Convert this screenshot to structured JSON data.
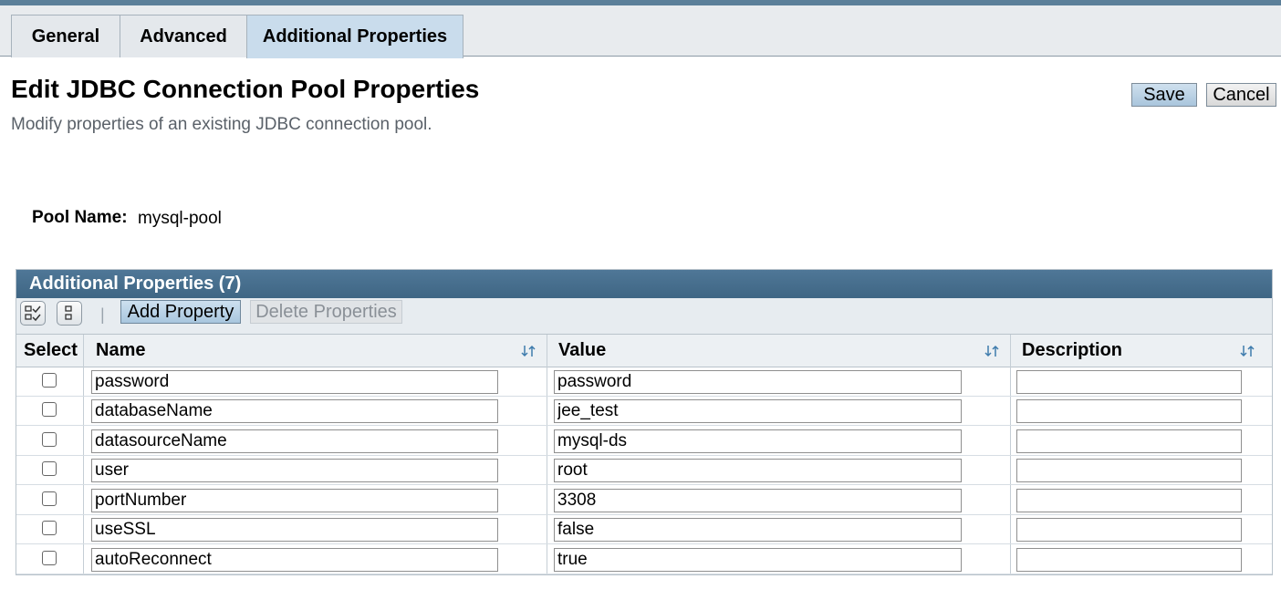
{
  "tabs": [
    {
      "label": "General"
    },
    {
      "label": "Advanced"
    },
    {
      "label": "Additional Properties"
    }
  ],
  "page": {
    "title": "Edit JDBC Connection Pool Properties",
    "help": "Modify properties of an existing JDBC connection pool."
  },
  "actions": {
    "save": "Save",
    "cancel": "Cancel"
  },
  "pool": {
    "label": "Pool Name:",
    "value": "mysql-pool"
  },
  "table": {
    "title": "Additional Properties (7)",
    "toolbar": {
      "select_all_icon": "select-all-icon",
      "deselect_all_icon": "deselect-all-icon",
      "separator": "|",
      "add": "Add Property",
      "delete": "Delete Properties"
    },
    "columns": {
      "select": "Select",
      "name": "Name",
      "value": "Value",
      "description": "Description"
    },
    "rows": [
      {
        "name": "password",
        "value": "password",
        "description": ""
      },
      {
        "name": "databaseName",
        "value": "jee_test",
        "description": ""
      },
      {
        "name": "datasourceName",
        "value": "mysql-ds",
        "description": ""
      },
      {
        "name": "user",
        "value": "root",
        "description": ""
      },
      {
        "name": "portNumber",
        "value": "3308",
        "description": ""
      },
      {
        "name": "useSSL",
        "value": "false",
        "description": ""
      },
      {
        "name": "autoReconnect",
        "value": "true",
        "description": ""
      }
    ]
  },
  "colors": {
    "accent": "#3f6684",
    "button": "#a8c6de"
  }
}
